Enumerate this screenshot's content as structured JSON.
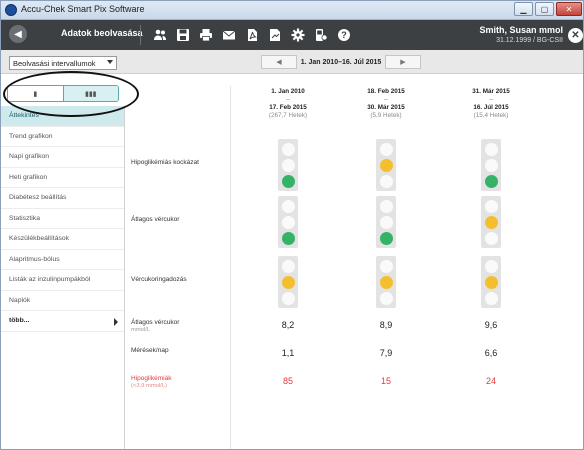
{
  "window": {
    "title": "Accu-Chek Smart Pix Software"
  },
  "toolbar": {
    "back_icon": "arrow-left-icon",
    "title": "Adatok beolvasása",
    "tools": [
      "users-icon",
      "save-icon",
      "print-icon",
      "mail-icon",
      "pdf-icon",
      "pdf-export-icon",
      "gear-icon",
      "device-settings-icon",
      "help-icon"
    ],
    "patient_name": "Smith, Susan mmol",
    "patient_dob": "31.12.1999 / BG-CSII"
  },
  "datestrip": {
    "interval_select": "Beolvasási intervallumok",
    "prev": "◀",
    "range": "1. Jan 2010–16. Júl 2015",
    "next": "▶"
  },
  "view_toggle": {
    "option_single": "▮",
    "option_multi": "▮▮▮",
    "selected": "multi"
  },
  "sidebar": {
    "items": [
      {
        "label": "Áttekintés",
        "active": true
      },
      {
        "label": "Trend grafikon"
      },
      {
        "label": "Napi grafikon"
      },
      {
        "label": "Heti grafikon"
      },
      {
        "label": "Diabétesz beállítás"
      },
      {
        "label": "Statisztika"
      },
      {
        "label": "Készülékbeállítások"
      },
      {
        "label": "Alapritmus-bólus"
      },
      {
        "label": "Listák az inzulinpumpákból"
      },
      {
        "label": "Naplók"
      },
      {
        "label": "több..."
      }
    ]
  },
  "periods": [
    {
      "start": "1. Jan 2010",
      "dash": "–",
      "end": "17. Feb 2015",
      "duration": "(267,7 Hetek)"
    },
    {
      "start": "18. Feb 2015",
      "dash": "–",
      "end": "30. Már 2015",
      "duration": "(5,9 Hetek)"
    },
    {
      "start": "31. Már 2015",
      "dash": "–",
      "end": "16. Júl 2015",
      "duration": "(15,4 Hetek)"
    }
  ],
  "rows": {
    "hypo_risk": {
      "label": "Hipoglikémiás kockázat",
      "levels": [
        "green",
        "yellow",
        "green"
      ]
    },
    "avg_bg_light": {
      "label": "Átlagos vércukor",
      "levels": [
        "green",
        "green",
        "yellow"
      ]
    },
    "bg_variability": {
      "label": "Vércukoringadozás",
      "levels": [
        "yellow",
        "yellow",
        "yellow"
      ]
    },
    "avg_bg": {
      "label": "Átlagos vércukor",
      "unit": "mmol/L",
      "values": [
        "8,2",
        "8,9",
        "9,6"
      ]
    },
    "tests_per_day": {
      "label": "Mérések/nap",
      "values": [
        "1,1",
        "7,9",
        "6,6"
      ]
    },
    "hypos": {
      "label": "Hipoglikémiák",
      "unit": "(<3,9 mmol/L)",
      "values": [
        "85",
        "15",
        "24"
      ]
    }
  },
  "colors": {
    "green": "#35b267",
    "yellow": "#f5be2e",
    "red": "#e23b3b",
    "accent": "#5aa8b2"
  }
}
